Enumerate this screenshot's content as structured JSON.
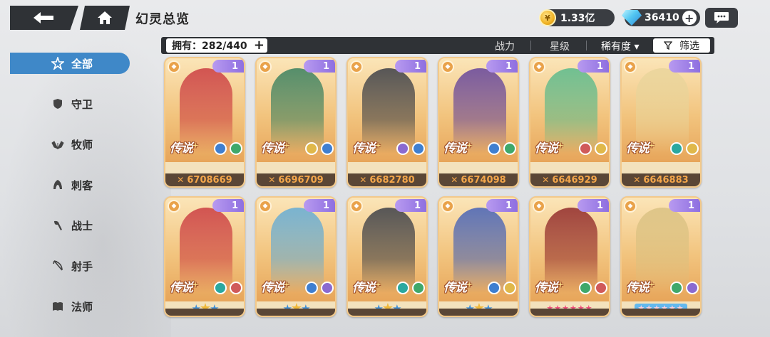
{
  "header": {
    "title": "幻灵总览",
    "gold": "1.33亿",
    "gems": "36410",
    "plus": "+"
  },
  "filter": {
    "owned_label": "拥有：282/440",
    "owned_plus": "+",
    "sort_power": "战力",
    "sort_stars": "星级",
    "sort_rarity": "稀有度 ▾",
    "filter_label": "筛选"
  },
  "sidebar": {
    "items": [
      {
        "label": "全部",
        "icon": "all-icon"
      },
      {
        "label": "守卫",
        "icon": "guardian-icon"
      },
      {
        "label": "牧师",
        "icon": "priest-icon"
      },
      {
        "label": "刺客",
        "icon": "assassin-icon"
      },
      {
        "label": "战士",
        "icon": "warrior-icon"
      },
      {
        "label": "射手",
        "icon": "archer-icon"
      },
      {
        "label": "法师",
        "icon": "mage-icon"
      }
    ]
  },
  "cards_row1": [
    {
      "rarity": "传说",
      "level": "1",
      "power": "6708669",
      "elements": [
        "#3f7fd0",
        "#3fa86a"
      ],
      "accent": "#c8323a"
    },
    {
      "rarity": "传说",
      "level": "1",
      "power": "6696709",
      "elements": [
        "#e0b84a",
        "#3f7fd0"
      ],
      "accent": "#2d7a5a"
    },
    {
      "rarity": "传说",
      "level": "1",
      "power": "6682780",
      "elements": [
        "#8a6ad0",
        "#3f7fd0"
      ],
      "accent": "#2f3440"
    },
    {
      "rarity": "传说",
      "level": "1",
      "power": "6674098",
      "elements": [
        "#3f7fd0",
        "#3fa86a"
      ],
      "accent": "#5b3a9a"
    },
    {
      "rarity": "传说",
      "level": "1",
      "power": "6646929",
      "elements": [
        "#d05a5a",
        "#e0b84a"
      ],
      "accent": "#4fb88a"
    },
    {
      "rarity": "传说",
      "level": "1",
      "power": "6646883",
      "elements": [
        "#2aa8a0",
        "#e0b84a"
      ],
      "accent": "#e8d49a"
    }
  ],
  "cards_row2": [
    {
      "rarity": "传说",
      "level": "1",
      "elements": [
        "#2aa8a0",
        "#d05a5a"
      ],
      "accent": "#c8323a",
      "stars": "emblem"
    },
    {
      "rarity": "传说",
      "level": "1",
      "elements": [
        "#3f7fd0",
        "#8a6ad0"
      ],
      "accent": "#5aa8d8",
      "stars": "emblem"
    },
    {
      "rarity": "传说",
      "level": "1",
      "elements": [
        "#2aa8a0",
        "#3fa86a"
      ],
      "accent": "#2f3440",
      "stars": "emblem"
    },
    {
      "rarity": "传说",
      "level": "1",
      "elements": [
        "#3f7fd0",
        "#e0b84a"
      ],
      "accent": "#3a5ab8",
      "stars": "emblem"
    },
    {
      "rarity": "传说",
      "level": "1",
      "elements": [
        "#3fa86a",
        "#d05a5a"
      ],
      "accent": "#8a1e22",
      "stars": "★★★★★★"
    },
    {
      "rarity": "传说",
      "level": "1",
      "elements": [
        "#3fa86a",
        "#8a6ad0"
      ],
      "accent": "#d8c080",
      "stars": "★★★★★★"
    }
  ]
}
